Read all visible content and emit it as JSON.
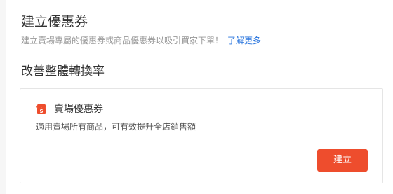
{
  "header": {
    "title": "建立優惠券",
    "description": "建立賣場專屬的優惠券或商品優惠券以吸引買家下單！",
    "learn_more_link": "了解更多"
  },
  "section": {
    "title": "改善整體轉換率"
  },
  "shop_voucher_card": {
    "icon": "shop-voucher-icon",
    "title": "賣場優惠券",
    "description": "適用賣場所有商品，可有效提升全店銷售額",
    "create_button": "建立"
  },
  "colors": {
    "accent": "#ee4d2d",
    "link": "#2673dd",
    "muted_text": "#999999"
  }
}
